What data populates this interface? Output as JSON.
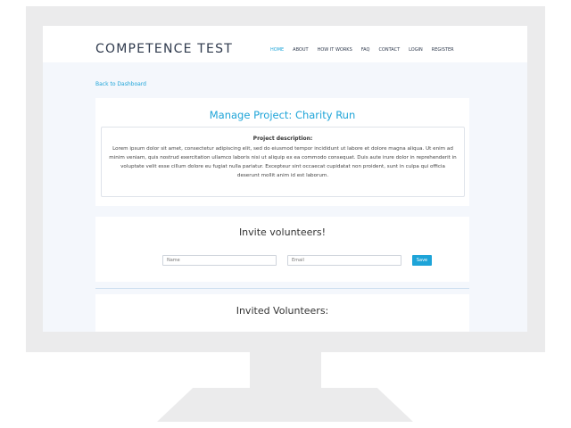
{
  "brand": "COMPETENCE TEST",
  "nav": [
    "HOME",
    "ABOUT",
    "HOW IT WORKS",
    "FAQ",
    "CONTACT",
    "LOGIN",
    "REGISTER"
  ],
  "back_link": "Back to Dashboard",
  "project": {
    "title": "Manage Project: Charity Run",
    "description_heading": "Project description:",
    "description": "Lorem ipsum dolor sit amet, consectetur adipiscing elit, sed do eiusmod tempor incididunt ut labore et dolore magna aliqua. Ut enim ad minim veniam, quis nostrud exercitation ullamco laboris nisi ut aliquip ex ea commodo consequat. Duis aute irure dolor in reprehenderit in voluptate velit esse cillum dolore eu fugiat nulla pariatur. Excepteur sint occaecat cupidatat non proident, sunt in culpa qui officia deserunt mollit anim id est laborum."
  },
  "invite": {
    "title": "Invite volunteers!",
    "name_placeholder": "Name",
    "email_placeholder": "Email",
    "save_label": "Save"
  },
  "invited": {
    "title": "Invited Volunteers:"
  },
  "colors": {
    "accent": "#1ea4d8",
    "frame": "#ebebec",
    "screen_bg": "#f4f7fc"
  }
}
